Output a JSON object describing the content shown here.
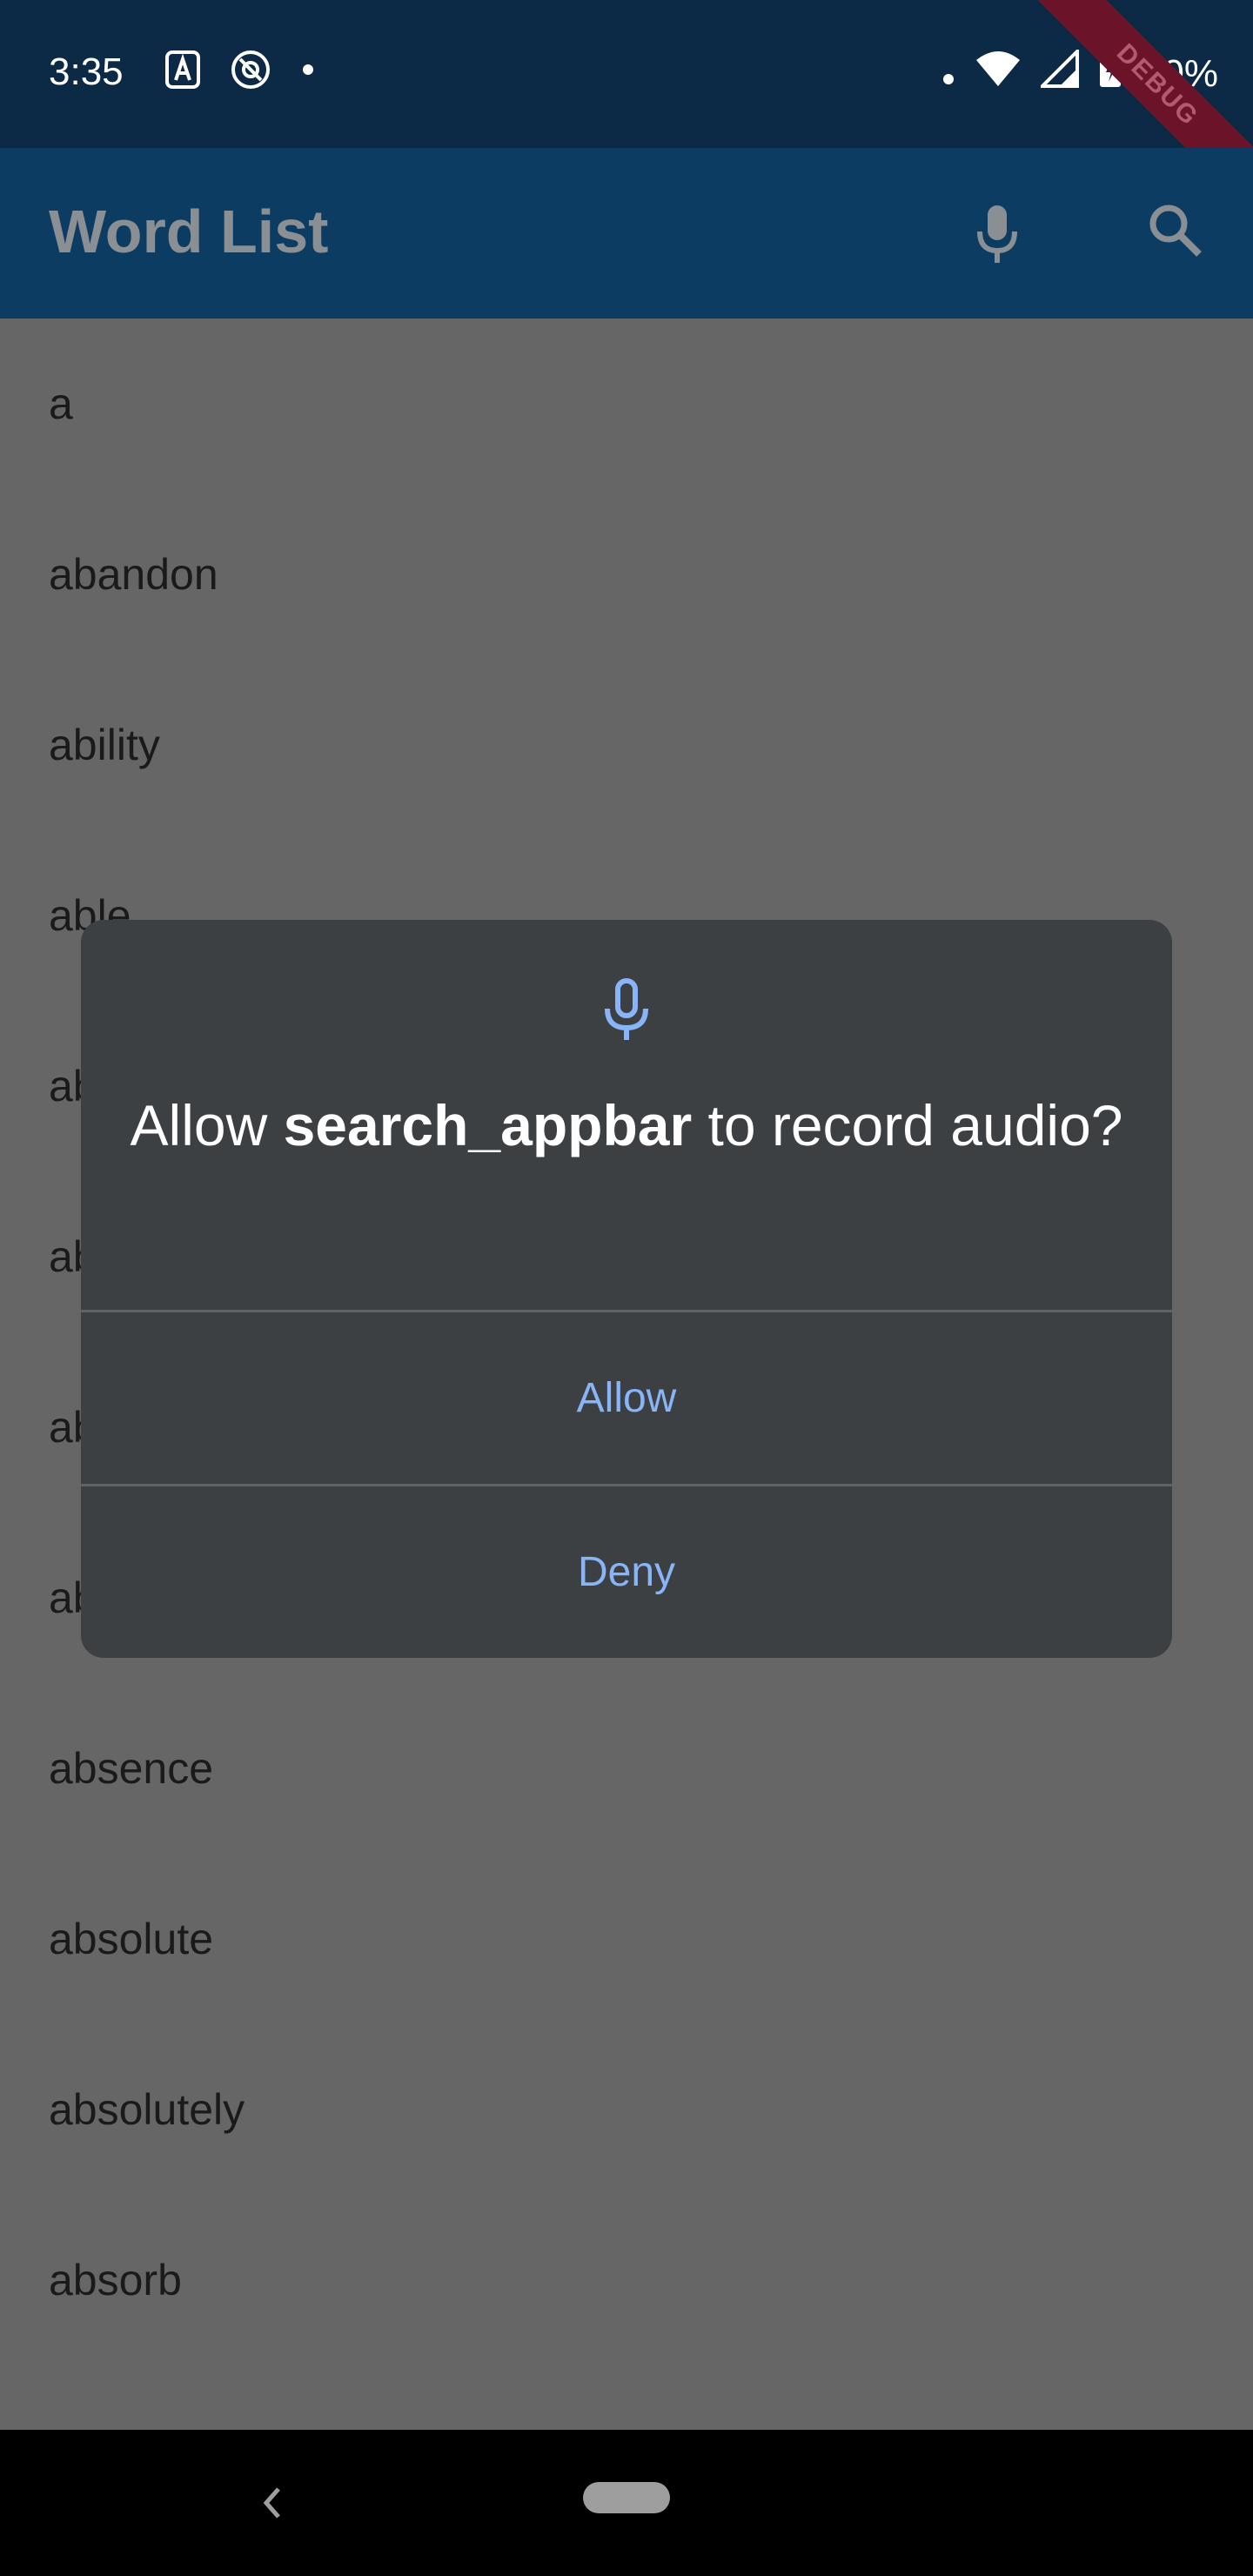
{
  "status_bar": {
    "time": "3:35",
    "battery": "90%",
    "debug_label": "DEBUG"
  },
  "app_bar": {
    "title": "Word List"
  },
  "words": [
    "a",
    "abandon",
    "ability",
    "able",
    "about",
    "above",
    "abroad",
    "absence",
    "absence",
    "absolute",
    "absolutely",
    "absorb"
  ],
  "dialog": {
    "title_prefix": "Allow ",
    "app_name": "search_appbar",
    "title_suffix": " to record audio?",
    "allow_label": "Allow",
    "deny_label": "Deny"
  },
  "colors": {
    "accent": "#8ab4f8",
    "dialog_bg": "#3c4043",
    "app_bar": "#0d3c63",
    "status_bar": "#0c2a45"
  },
  "icons": [
    "a-icon",
    "at-icon",
    "dot-icon",
    "wifi-icon",
    "signal-icon",
    "battery-icon",
    "mic-icon",
    "search-icon",
    "back-icon"
  ]
}
